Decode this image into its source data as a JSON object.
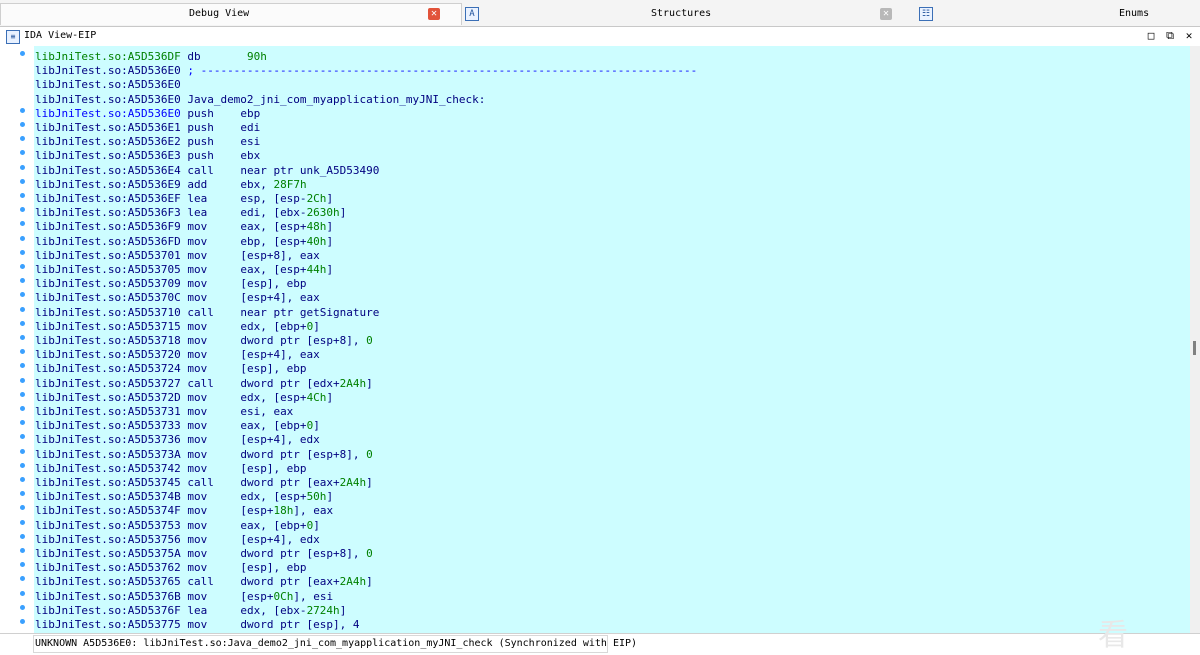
{
  "tabs": [
    {
      "label": "Debug View"
    },
    {
      "label": "Structures"
    },
    {
      "label": "Enums"
    }
  ],
  "window": {
    "title": "IDA View-EIP"
  },
  "colors": {
    "code_bg": "#cdfdff",
    "address": "#000080",
    "current_address": "#0000ff",
    "operand_number": "#008000",
    "breakpoint_dot": "#3aa0ff"
  },
  "code_lines": [
    {
      "addr": "libJniTest.so:A5D536DF",
      "mn": "db",
      "op": " 90h",
      "dot": true,
      "addrGreen": true
    },
    {
      "addr": "libJniTest.so:A5D536E0",
      "mn": "",
      "op": "; ---------------------------------------------------------------------------",
      "dot": false
    },
    {
      "addr": "libJniTest.so:A5D536E0",
      "mn": "",
      "op": "",
      "dot": false
    },
    {
      "addr": "libJniTest.so:A5D536E0",
      "mn": "",
      "op": "Java_demo2_jni_com_myapplication_myJNI_check:",
      "dot": false
    },
    {
      "addr": "libJniTest.so:A5D536E0",
      "mn": "push",
      "op": "ebp",
      "dot": true,
      "cur": true
    },
    {
      "addr": "libJniTest.so:A5D536E1",
      "mn": "push",
      "op": "edi",
      "dot": true
    },
    {
      "addr": "libJniTest.so:A5D536E2",
      "mn": "push",
      "op": "esi",
      "dot": true
    },
    {
      "addr": "libJniTest.so:A5D536E3",
      "mn": "push",
      "op": "ebx",
      "dot": true
    },
    {
      "addr": "libJniTest.so:A5D536E4",
      "mn": "call",
      "op": "near ptr unk_A5D53490",
      "dot": true
    },
    {
      "addr": "libJniTest.so:A5D536E9",
      "mn": "add",
      "op": "ebx, 28F7h",
      "dot": true
    },
    {
      "addr": "libJniTest.so:A5D536EF",
      "mn": "lea",
      "op": "esp, [esp-2Ch]",
      "dot": true
    },
    {
      "addr": "libJniTest.so:A5D536F3",
      "mn": "lea",
      "op": "edi, [ebx-2630h]",
      "dot": true
    },
    {
      "addr": "libJniTest.so:A5D536F9",
      "mn": "mov",
      "op": "eax, [esp+48h]",
      "dot": true
    },
    {
      "addr": "libJniTest.so:A5D536FD",
      "mn": "mov",
      "op": "ebp, [esp+40h]",
      "dot": true
    },
    {
      "addr": "libJniTest.so:A5D53701",
      "mn": "mov",
      "op": "[esp+8], eax",
      "dot": true
    },
    {
      "addr": "libJniTest.so:A5D53705",
      "mn": "mov",
      "op": "eax, [esp+44h]",
      "dot": true
    },
    {
      "addr": "libJniTest.so:A5D53709",
      "mn": "mov",
      "op": "[esp], ebp",
      "dot": true
    },
    {
      "addr": "libJniTest.so:A5D5370C",
      "mn": "mov",
      "op": "[esp+4], eax",
      "dot": true
    },
    {
      "addr": "libJniTest.so:A5D53710",
      "mn": "call",
      "op": "near ptr getSignature",
      "dot": true
    },
    {
      "addr": "libJniTest.so:A5D53715",
      "mn": "mov",
      "op": "edx, [ebp+0]",
      "dot": true
    },
    {
      "addr": "libJniTest.so:A5D53718",
      "mn": "mov",
      "op": "dword ptr [esp+8], 0",
      "dot": true
    },
    {
      "addr": "libJniTest.so:A5D53720",
      "mn": "mov",
      "op": "[esp+4], eax",
      "dot": true
    },
    {
      "addr": "libJniTest.so:A5D53724",
      "mn": "mov",
      "op": "[esp], ebp",
      "dot": true
    },
    {
      "addr": "libJniTest.so:A5D53727",
      "mn": "call",
      "op": "dword ptr [edx+2A4h]",
      "dot": true
    },
    {
      "addr": "libJniTest.so:A5D5372D",
      "mn": "mov",
      "op": "edx, [esp+4Ch]",
      "dot": true
    },
    {
      "addr": "libJniTest.so:A5D53731",
      "mn": "mov",
      "op": "esi, eax",
      "dot": true
    },
    {
      "addr": "libJniTest.so:A5D53733",
      "mn": "mov",
      "op": "eax, [ebp+0]",
      "dot": true
    },
    {
      "addr": "libJniTest.so:A5D53736",
      "mn": "mov",
      "op": "[esp+4], edx",
      "dot": true
    },
    {
      "addr": "libJniTest.so:A5D5373A",
      "mn": "mov",
      "op": "dword ptr [esp+8], 0",
      "dot": true
    },
    {
      "addr": "libJniTest.so:A5D53742",
      "mn": "mov",
      "op": "[esp], ebp",
      "dot": true
    },
    {
      "addr": "libJniTest.so:A5D53745",
      "mn": "call",
      "op": "dword ptr [eax+2A4h]",
      "dot": true
    },
    {
      "addr": "libJniTest.so:A5D5374B",
      "mn": "mov",
      "op": "edx, [esp+50h]",
      "dot": true
    },
    {
      "addr": "libJniTest.so:A5D5374F",
      "mn": "mov",
      "op": "[esp+18h], eax",
      "dot": true
    },
    {
      "addr": "libJniTest.so:A5D53753",
      "mn": "mov",
      "op": "eax, [ebp+0]",
      "dot": true
    },
    {
      "addr": "libJniTest.so:A5D53756",
      "mn": "mov",
      "op": "[esp+4], edx",
      "dot": true
    },
    {
      "addr": "libJniTest.so:A5D5375A",
      "mn": "mov",
      "op": "dword ptr [esp+8], 0",
      "dot": true
    },
    {
      "addr": "libJniTest.so:A5D53762",
      "mn": "mov",
      "op": "[esp], ebp",
      "dot": true
    },
    {
      "addr": "libJniTest.so:A5D53765",
      "mn": "call",
      "op": "dword ptr [eax+2A4h]",
      "dot": true
    },
    {
      "addr": "libJniTest.so:A5D5376B",
      "mn": "mov",
      "op": "[esp+0Ch], esi",
      "dot": true
    },
    {
      "addr": "libJniTest.so:A5D5376F",
      "mn": "lea",
      "op": "edx, [ebx-2724h]",
      "dot": true
    },
    {
      "addr": "libJniTest.so:A5D53775",
      "mn": "mov",
      "op": "dword ptr [esp], 4",
      "dot": true
    }
  ],
  "status": {
    "text": "UNKNOWN A5D536E0: libJniTest.so:Java_demo2_jni_com_myapplication_myJNI_check (Synchronized with EIP)"
  },
  "watermark": "看"
}
